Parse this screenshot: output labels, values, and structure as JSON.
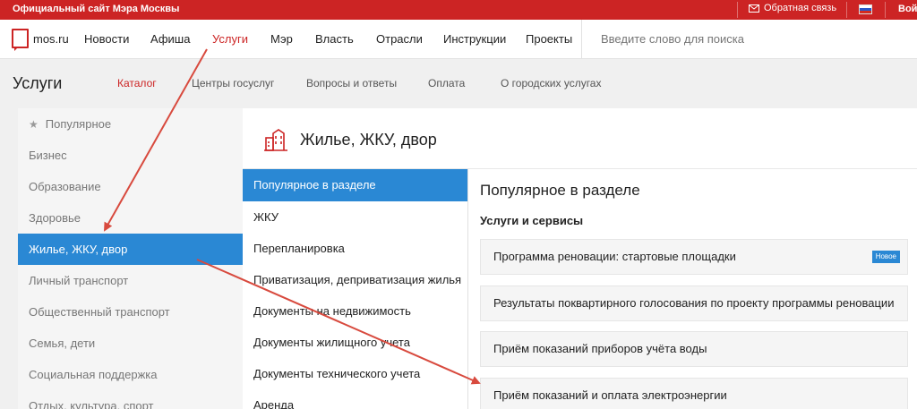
{
  "topbar": {
    "site_name": "Официальный сайт Мэра Москвы",
    "feedback": "Обратная связь",
    "login": "Вой",
    "accent": "#cc2424"
  },
  "navbar": {
    "logo": "mos.ru",
    "items": [
      "Новости",
      "Афиша",
      "Услуги",
      "Мэр",
      "Власть",
      "Отрасли",
      "Инструкции",
      "Проекты"
    ],
    "active_item": "Услуги",
    "search_placeholder": "Введите слово для поиска"
  },
  "subheader": {
    "title": "Услуги",
    "tabs": [
      "Каталог",
      "Центры госуслуг",
      "Вопросы и ответы",
      "Оплата",
      "О городских услугах"
    ],
    "active_tab": "Каталог"
  },
  "categories": {
    "items": [
      "Популярное",
      "Бизнес",
      "Образование",
      "Здоровье",
      "Жилье, ЖКУ, двор",
      "Личный транспорт",
      "Общественный транспорт",
      "Семья, дети",
      "Социальная поддержка",
      "Отдых, культура, спорт"
    ],
    "active_item": "Жилье, ЖКУ, двор",
    "highlight": "#2a88d4"
  },
  "section": {
    "title": "Жилье, ЖКУ, двор",
    "icon": "buildings-icon",
    "subcategories": [
      "Популярное в разделе",
      "ЖКУ",
      "Перепланировка",
      "Приватизация, деприватизация жилья",
      "Документы на недвижимость",
      "Документы жилищного учета",
      "Документы технического учета",
      "Аренда"
    ],
    "active_subcategory": "Популярное в разделе"
  },
  "content": {
    "heading": "Популярное в разделе",
    "subheading": "Услуги и сервисы",
    "services": [
      {
        "label": "Программа реновации: стартовые площадки",
        "badge": "Новое"
      },
      {
        "label": "Результаты поквартирного голосования по проекту программы реновации"
      },
      {
        "label": "Приём показаний приборов учёта воды"
      },
      {
        "label": "Приём показаний и оплата электроэнергии"
      }
    ]
  },
  "annotation": {
    "arrow_color": "#d84a3e"
  }
}
